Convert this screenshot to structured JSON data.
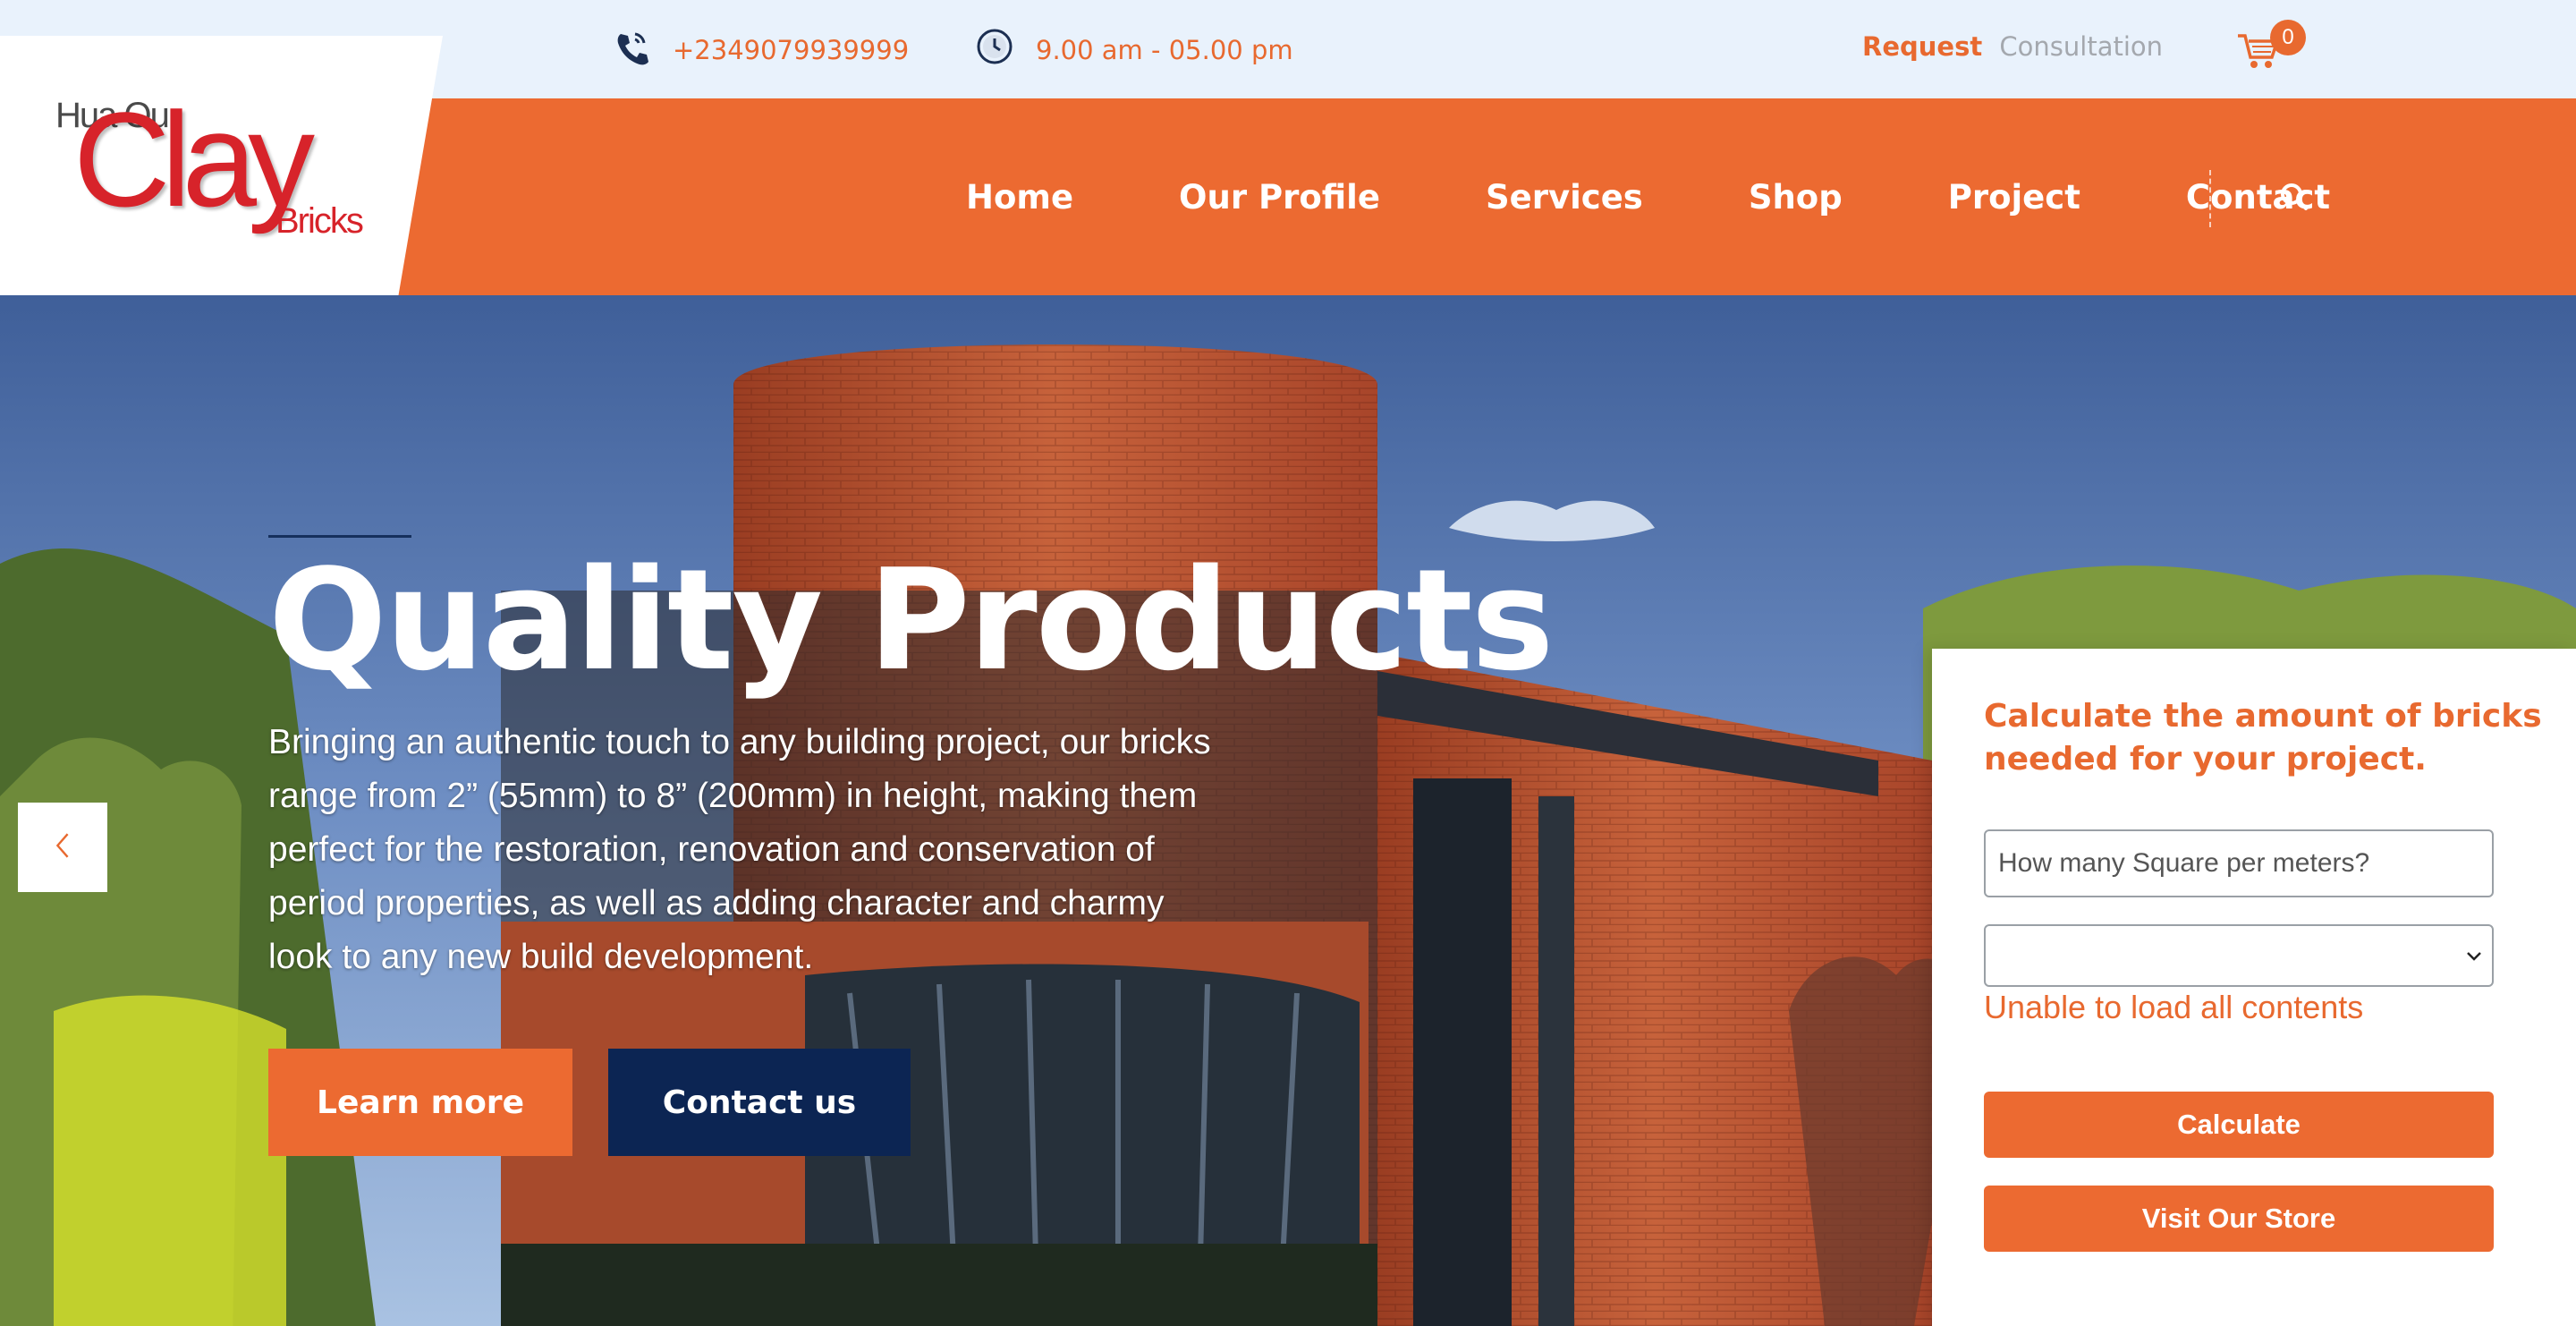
{
  "topbar": {
    "phone": "+2349079939999",
    "hours": "9.00 am - 05.00 pm",
    "request_label": "Request",
    "consultation_label": "Consultation",
    "cart_count": "0",
    "icons": [
      "phone-icon",
      "clock-icon",
      "cart-icon"
    ]
  },
  "logo": {
    "line1": "Hua Ou",
    "line2": "Clay",
    "line3": "Bricks"
  },
  "nav": {
    "items": [
      {
        "label": "Home"
      },
      {
        "label": "Our Profile"
      },
      {
        "label": "Services"
      },
      {
        "label": "Shop"
      },
      {
        "label": "Project"
      },
      {
        "label": "Contact"
      }
    ],
    "search_icon": "search-icon"
  },
  "hero": {
    "title": "Quality Products",
    "text": "Bringing an authentic touch to any building project, our bricks range from 2” (55mm) to 8” (200mm) in height, making them perfect for the restoration, renovation and conservation of period properties, as well as adding character and charmy look to any new build development.",
    "learn_more": "Learn more",
    "contact_us": "Contact us"
  },
  "calculator": {
    "title": "Calculate the amount of bricks needed for your project.",
    "input_placeholder": "How many Square per meters?",
    "select_value": "",
    "error": "Unable to load all contents",
    "calculate_label": "Calculate",
    "store_label": "Visit Our Store"
  },
  "colors": {
    "accent": "#ec6a31",
    "navy": "#0c2553",
    "topbar_bg": "#e9f2fc"
  }
}
